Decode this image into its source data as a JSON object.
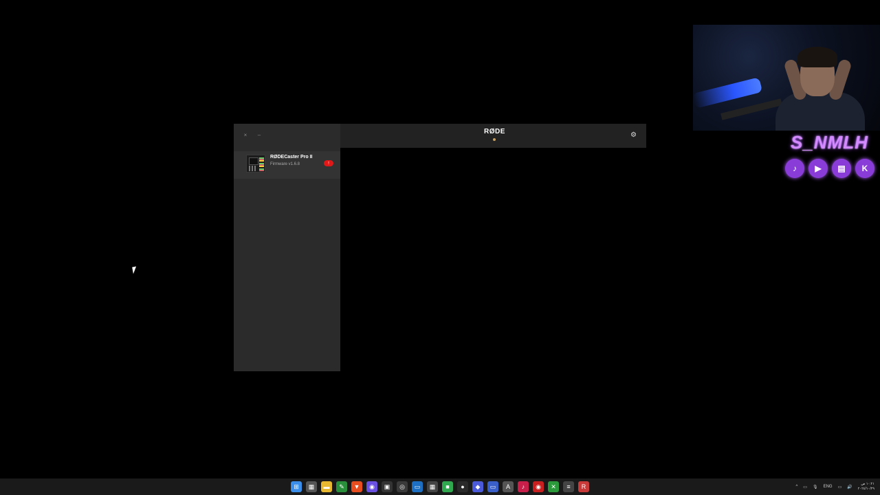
{
  "app": {
    "window_controls": {
      "close": "×",
      "minimize": "–"
    },
    "logo": "RØDE",
    "settings_icon": "gear-icon",
    "devices": [
      {
        "name": "RØDECaster Pro II",
        "firmware": "Firmware v1.6.8",
        "update_icon": "↑"
      }
    ]
  },
  "overlay": {
    "channel_name": "S_NMLH",
    "socials": [
      {
        "icon": "tiktok-icon",
        "glyph": "♪"
      },
      {
        "icon": "youtube-icon",
        "glyph": "▶"
      },
      {
        "icon": "twitch-icon",
        "glyph": "▤"
      },
      {
        "icon": "kick-icon",
        "glyph": "K"
      }
    ]
  },
  "taskbar": {
    "icons": [
      {
        "name": "start-icon",
        "glyph": "⊞",
        "color": "#3b8eea"
      },
      {
        "name": "calendar-icon",
        "glyph": "▦",
        "color": "#555"
      },
      {
        "name": "file-explorer-icon",
        "glyph": "▬",
        "color": "#e8b830"
      },
      {
        "name": "notepad-icon",
        "glyph": "✎",
        "color": "#2a8f3a"
      },
      {
        "name": "brave-icon",
        "glyph": "▼",
        "color": "#e84d20"
      },
      {
        "name": "discord-icon",
        "glyph": "◉",
        "color": "#6a50e0"
      },
      {
        "name": "app-dark-icon",
        "glyph": "▣",
        "color": "#333"
      },
      {
        "name": "chrome-icon",
        "glyph": "◎",
        "color": "#3a3a3a"
      },
      {
        "name": "window-icon",
        "glyph": "▭",
        "color": "#1d6fc4"
      },
      {
        "name": "grid-icon",
        "glyph": "▦",
        "color": "#444"
      },
      {
        "name": "lock-icon",
        "glyph": "■",
        "color": "#2fa84f"
      },
      {
        "name": "steam-icon",
        "glyph": "●",
        "color": "#2a2a2a"
      },
      {
        "name": "diamond-icon",
        "glyph": "◆",
        "color": "#4a5ad8"
      },
      {
        "name": "monitor-icon",
        "glyph": "▭",
        "color": "#3a5fc8"
      },
      {
        "name": "tools-icon",
        "glyph": "A",
        "color": "#555"
      },
      {
        "name": "tiktok-app-icon",
        "glyph": "♪",
        "color": "#c81e4a"
      },
      {
        "name": "record-icon",
        "glyph": "◉",
        "color": "#c82020"
      },
      {
        "name": "xbox-icon",
        "glyph": "✕",
        "color": "#2a9a3a"
      },
      {
        "name": "audio-icon",
        "glyph": "≡",
        "color": "#444"
      },
      {
        "name": "rode-central-icon",
        "glyph": "R",
        "color": "#c83a3a"
      }
    ],
    "tray": {
      "chevron": "^",
      "battery": "▭",
      "mic": "🎙",
      "lang": "ENG",
      "network": "▭",
      "volume": "🔊",
      "time": "١٠:٢١ ص",
      "date": "٢٠٢٤/١٠/٢٩"
    }
  }
}
